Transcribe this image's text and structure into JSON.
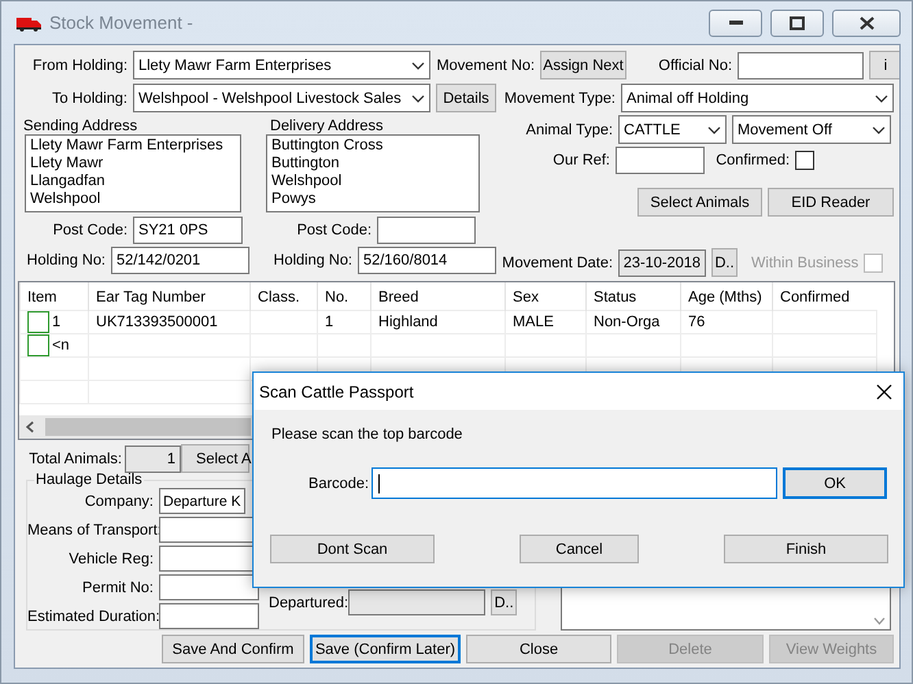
{
  "window": {
    "title": "Stock Movement -"
  },
  "header": {
    "from_holding": {
      "label": "From Holding:",
      "value": "Llety Mawr Farm Enterprises"
    },
    "movement_no": {
      "label": "Movement No:",
      "button": "Assign Next"
    },
    "official_no": {
      "label": "Official No:",
      "button": "i"
    },
    "to_holding": {
      "label": "To Holding:",
      "value": "Welshpool - Welshpool Livestock Sales",
      "button": "Details"
    },
    "movement_type": {
      "label": "Movement Type:",
      "value": "Animal off Holding"
    },
    "sending_address": {
      "label": "Sending Address",
      "lines": [
        "Llety Mawr Farm Enterprises",
        "Llety Mawr",
        "Llangadfan",
        "Welshpool"
      ],
      "post_code_label": "Post Code:",
      "post_code": "SY21 0PS",
      "holding_no_label": "Holding No:",
      "holding_no": "52/142/0201"
    },
    "delivery_address": {
      "label": "Delivery Address",
      "lines": [
        "Buttington Cross",
        "Buttington",
        "Welshpool",
        "Powys"
      ],
      "post_code_label": "Post Code:",
      "holding_no_label": "Holding No:",
      "holding_no": "52/160/8014"
    },
    "animal_type": {
      "label": "Animal Type:",
      "value": "CATTLE",
      "direction": "Movement Off"
    },
    "our_ref": {
      "label": "Our Ref:"
    },
    "confirmed": {
      "label": "Confirmed:",
      "checked": false
    },
    "buttons": [
      "Select Animals",
      "EID Reader"
    ],
    "movement_date": {
      "label": "Movement Date:",
      "value": "23-10-2018",
      "button": "D.."
    },
    "within_business": {
      "label": "Within Business",
      "checked": false,
      "disabled": true
    }
  },
  "grid": {
    "columns": [
      "Item",
      "Ear Tag Number",
      "Class.",
      "No.",
      "Breed",
      "Sex",
      "Status",
      "Age (Mths)",
      "Confirmed"
    ],
    "rows": [
      {
        "checked": false,
        "cells": [
          "1",
          "UK713393500001",
          null,
          "1",
          "Highland",
          "MALE",
          "Non-Orga",
          "76",
          null
        ]
      },
      {
        "checked": false,
        "cells": [
          "<n"
        ]
      }
    ]
  },
  "bottom": {
    "total_animals": {
      "label": "Total Animals:",
      "value": "1",
      "button": "Select A"
    },
    "haulage": {
      "title": "Haulage Details",
      "fields": [
        {
          "label": "Company:",
          "value": "Departure K"
        },
        {
          "label": "Means of Transport:"
        },
        {
          "label": "Vehicle Reg:"
        },
        {
          "label": "Permit No:"
        },
        {
          "label": "Estimated Duration:"
        }
      ]
    },
    "departured": {
      "label": "Departured:",
      "button": "D.."
    }
  },
  "actions": [
    {
      "label": "Save And Confirm",
      "disabled": false,
      "default": false
    },
    {
      "label": "Save (Confirm Later)",
      "disabled": false,
      "default": true
    },
    {
      "label": "Close",
      "disabled": false,
      "default": false
    },
    {
      "label": "Delete",
      "disabled": true,
      "default": false
    },
    {
      "label": "View Weights",
      "disabled": true,
      "default": false
    }
  ],
  "dialog": {
    "title": "Scan Cattle Passport",
    "message": "Please scan the top barcode",
    "barcode_label": "Barcode:",
    "ok": "OK",
    "buttons": [
      "Dont Scan",
      "Cancel",
      "Finish"
    ]
  }
}
